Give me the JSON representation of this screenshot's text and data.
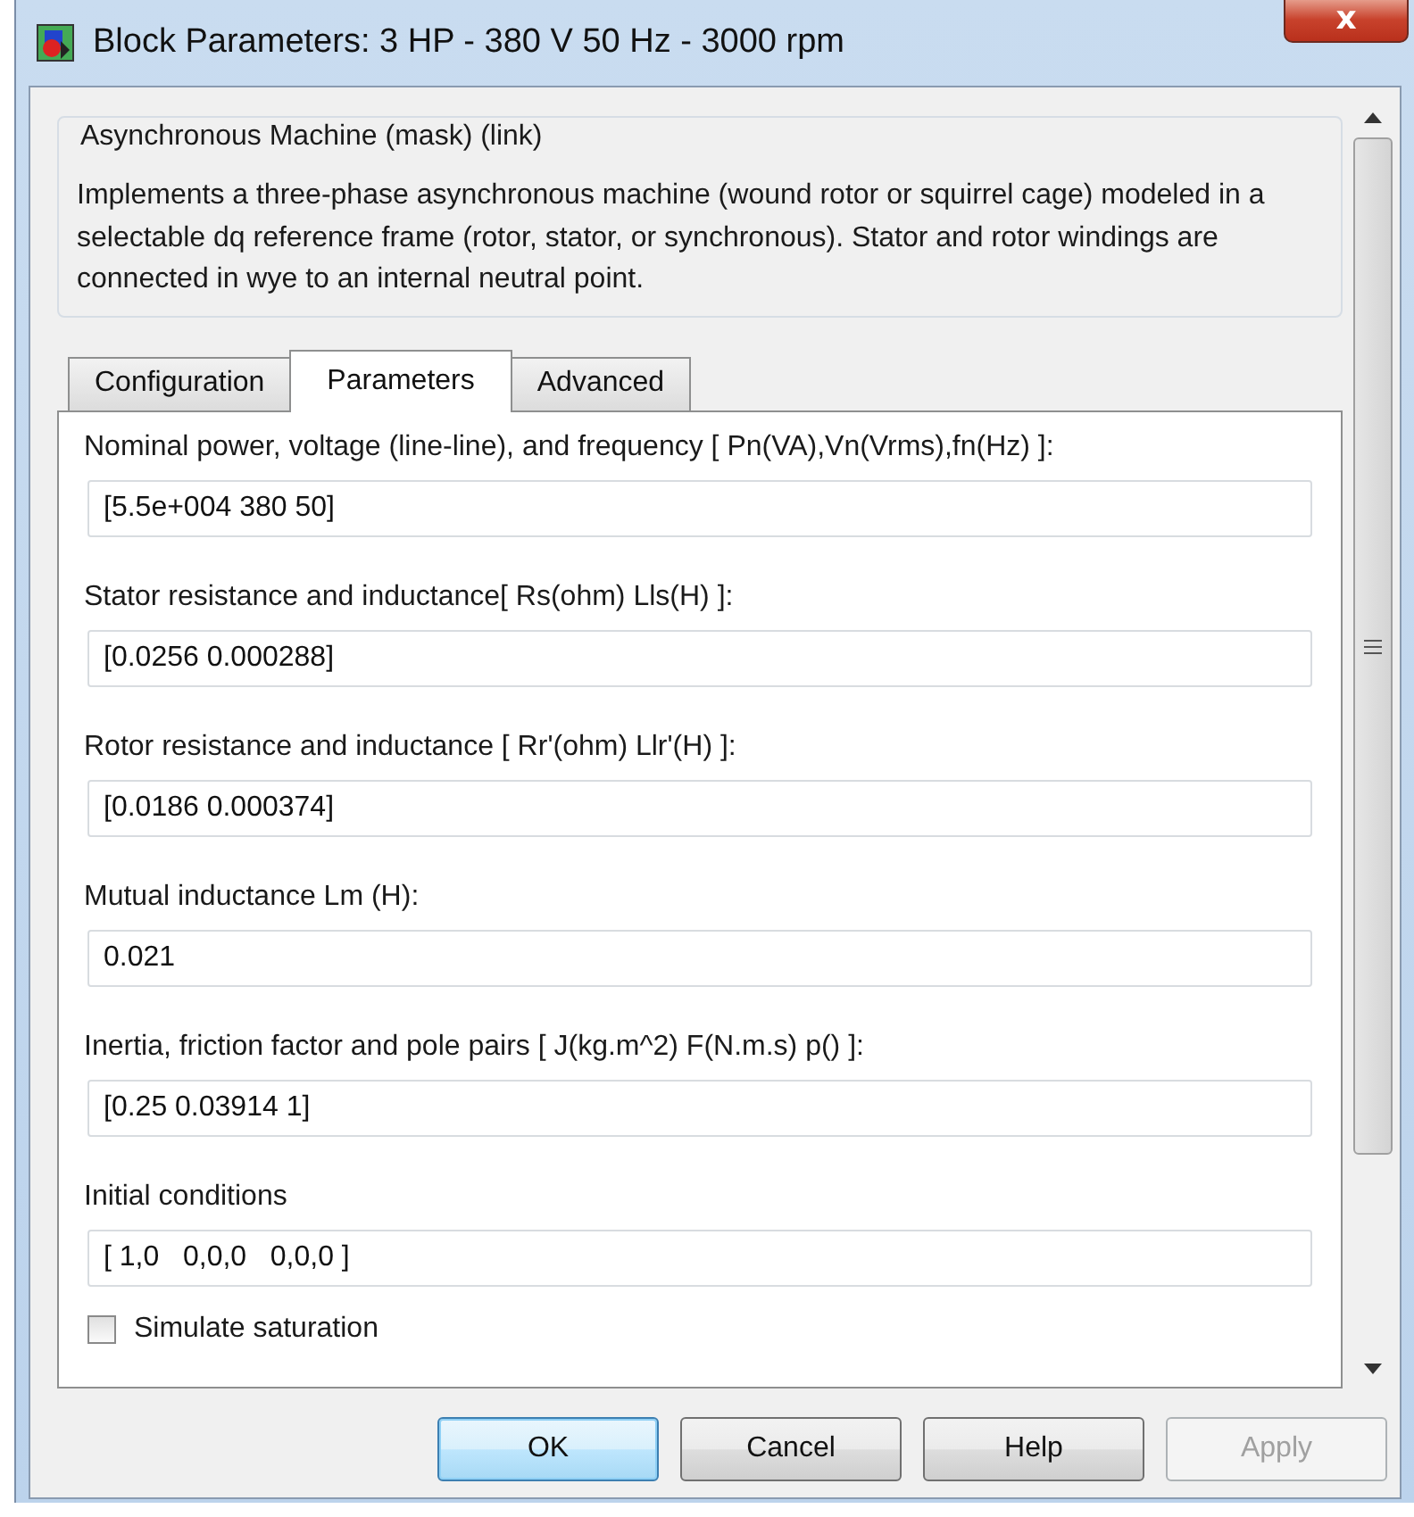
{
  "window": {
    "title": "Block Parameters: 3 HP - 380 V 50 Hz - 3000 rpm",
    "close": "x"
  },
  "description": {
    "title": "Asynchronous Machine (mask) (link)",
    "text": "Implements a three-phase asynchronous machine (wound rotor or squirrel cage) modeled in a selectable  dq reference frame (rotor, stator, or synchronous). Stator and rotor windings are connected in wye to an internal neutral point."
  },
  "tabs": [
    {
      "label": "Configuration",
      "selected": false
    },
    {
      "label": "Parameters",
      "selected": true
    },
    {
      "label": "Advanced",
      "selected": false
    }
  ],
  "parameters": [
    {
      "kind": "field",
      "label": "Nominal power, voltage (line-line), and frequency [ Pn(VA),Vn(Vrms),fn(Hz) ]:",
      "value": "[5.5e+004 380 50]"
    },
    {
      "kind": "field",
      "label": "Stator resistance and inductance[ Rs(ohm)  Lls(H) ]:",
      "value": "[0.0256 0.000288]"
    },
    {
      "kind": "field",
      "label": "Rotor resistance and inductance [ Rr'(ohm)  Llr'(H) ]:",
      "value": "[0.0186 0.000374]"
    },
    {
      "kind": "field",
      "label": "Mutual inductance Lm (H):",
      "value": "0.021"
    },
    {
      "kind": "field",
      "label": "Inertia, friction factor and pole pairs [ J(kg.m^2)  F(N.m.s)  p() ]:",
      "value": "[0.25 0.03914 1]"
    },
    {
      "kind": "field",
      "label": "Initial conditions",
      "value": "[ 1,0   0,0,0   0,0,0 ]"
    },
    {
      "kind": "checkbox",
      "label": "Simulate saturation",
      "checked": false
    }
  ],
  "buttons": [
    {
      "label": "OK",
      "default": true,
      "disabled": false
    },
    {
      "label": "Cancel",
      "default": false,
      "disabled": false
    },
    {
      "label": "Help",
      "default": false,
      "disabled": false
    },
    {
      "label": "Apply",
      "default": false,
      "disabled": true
    }
  ]
}
